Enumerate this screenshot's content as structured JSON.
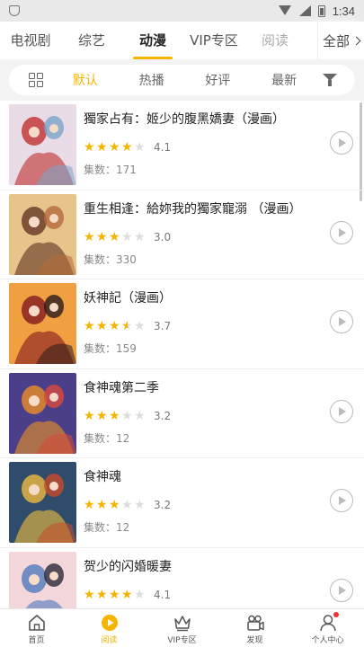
{
  "status_bar": {
    "time": "1:34"
  },
  "top_tabs": [
    {
      "label": "电视剧",
      "state": "normal"
    },
    {
      "label": "综艺",
      "state": "normal"
    },
    {
      "label": "动漫",
      "state": "active"
    },
    {
      "label": "VIP专区",
      "state": "normal"
    },
    {
      "label": "阅读",
      "state": "faded"
    }
  ],
  "all_tab": {
    "label": "全部"
  },
  "filter": {
    "options": [
      {
        "label": "默认",
        "active": true
      },
      {
        "label": "热播",
        "active": false
      },
      {
        "label": "好评",
        "active": false
      },
      {
        "label": "最新",
        "active": false
      }
    ]
  },
  "list": [
    {
      "title": "獨家占有：姬少的腹黑嬌妻（漫画）",
      "rating": 4.1,
      "score": "4.1",
      "episodes": "集数：171",
      "cover_colors": [
        "#e9dce6",
        "#c23a3a",
        "#7aa4c8"
      ]
    },
    {
      "title": "重生相逢：給妳我的獨家寵溺 （漫画）",
      "rating": 3.0,
      "score": "3.0",
      "episodes": "集数：330",
      "cover_colors": [
        "#e6c48a",
        "#6b3f2a",
        "#b66a3c"
      ]
    },
    {
      "title": "妖神記（漫画）",
      "rating": 3.7,
      "score": "3.7",
      "episodes": "集数：159",
      "cover_colors": [
        "#f0a040",
        "#8a2222",
        "#2b1a1a"
      ]
    },
    {
      "title": "食神魂第二季",
      "rating": 3.2,
      "score": "3.2",
      "episodes": "集数：12",
      "cover_colors": [
        "#4c3f8a",
        "#e08a2a",
        "#d94a3a"
      ]
    },
    {
      "title": "食神魂",
      "rating": 3.2,
      "score": "3.2",
      "episodes": "集数：12",
      "cover_colors": [
        "#2f4d6a",
        "#e3b341",
        "#c64a2a"
      ]
    },
    {
      "title": "贺少的闪婚暖妻",
      "rating": 4.1,
      "score": "4.1",
      "episodes": "",
      "cover_colors": [
        "#f3d7da",
        "#5a7fc0",
        "#2a2a3a"
      ]
    }
  ],
  "bottom_nav": [
    {
      "label": "首页",
      "icon": "home-icon",
      "active": false
    },
    {
      "label": "阅读",
      "icon": "play-circle-icon",
      "active": true
    },
    {
      "label": "VIP专区",
      "icon": "crown-icon",
      "active": false
    },
    {
      "label": "发现",
      "icon": "camera-icon",
      "active": false
    },
    {
      "label": "个人中心",
      "icon": "user-icon",
      "active": false,
      "badge": true
    }
  ],
  "colors": {
    "accent": "#f5b400",
    "star_off": "#dddddd",
    "badge": "#e33333"
  }
}
